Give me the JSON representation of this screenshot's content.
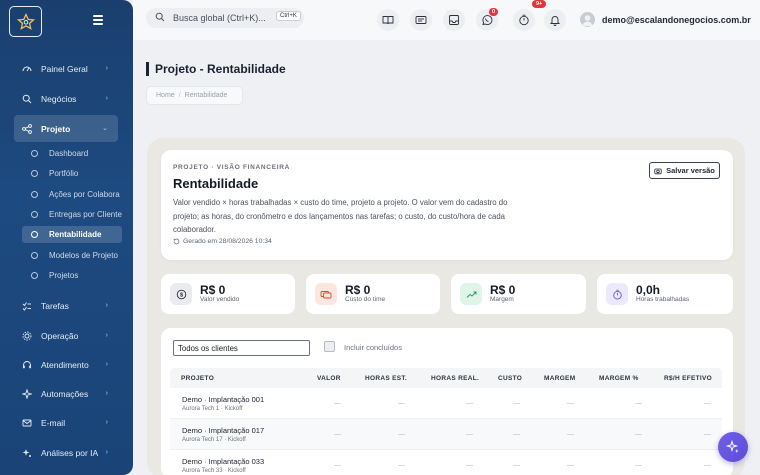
{
  "sidebar": {
    "items": [
      {
        "label": "Painel Geral",
        "icon": "dashboard-icon"
      },
      {
        "label": "Negócios",
        "icon": "search-icon"
      },
      {
        "label": "Projeto",
        "icon": "share-icon"
      },
      {
        "label": "Tarefas",
        "icon": "tasks-icon"
      },
      {
        "label": "Operação",
        "icon": "operation-icon"
      },
      {
        "label": "Atendimento",
        "icon": "headset-icon"
      },
      {
        "label": "Automações",
        "icon": "automation-icon"
      },
      {
        "label": "E-mail",
        "icon": "mail-icon"
      },
      {
        "label": "Análises por IA",
        "icon": "ai-icon"
      }
    ],
    "sub_items": [
      {
        "label": "Dashboard"
      },
      {
        "label": "Portfólio"
      },
      {
        "label": "Ações por Colabora"
      },
      {
        "label": "Entregas por Cliente"
      },
      {
        "label": "Rentabilidade"
      },
      {
        "label": "Modelos de Projeto"
      },
      {
        "label": "Projetos"
      }
    ]
  },
  "topbar": {
    "search_placeholder": "Busca global (Ctrl+K)...",
    "shortcut": "Ctrl+K",
    "whatsapp_badge": "0",
    "notifications_badge": "9+",
    "user_email": "demo@escalandonegocios.com.br"
  },
  "page": {
    "title": "Projeto - Rentabilidade",
    "breadcrumb_home": "Home",
    "breadcrumb_current": "Rentabilidade"
  },
  "hero": {
    "kicker": "PROJETO · VISÃO FINANCEIRA",
    "title": "Rentabilidade",
    "description": "Valor vendido × horas trabalhadas × custo do time, projeto a projeto. O valor vem do cadastro do projeto; as horas, do cronômetro e dos lançamentos nas tarefas; o custo, do custo/hora de cada colaborador.",
    "generated": "Gerado em 28/08/2026 10:34",
    "save_label": "Salvar versão"
  },
  "kpis": [
    {
      "value": "R$ 0",
      "label": "Valor vendido",
      "color": "#e9ebef"
    },
    {
      "value": "R$ 0",
      "label": "Custo do time",
      "color": "#fde6e0"
    },
    {
      "value": "R$ 0",
      "label": "Margem",
      "color": "#dff5e8"
    },
    {
      "value": "0,0h",
      "label": "Horas trabalhadas",
      "color": "#ebe9fb"
    }
  ],
  "filters": {
    "client_select": "Todos os clientes",
    "include_done_label": "Incluir concluídos"
  },
  "table": {
    "columns": [
      "PROJETO",
      "VALOR",
      "HORAS EST.",
      "HORAS REAL.",
      "CUSTO",
      "MARGEM",
      "MARGEM %",
      "R$/H EFETIVO"
    ],
    "rows": [
      {
        "name": "Demo · Implantação 001",
        "sub": "Aurora Tech 1 · Kickoff",
        "cells": [
          "—",
          "—",
          "—",
          "—",
          "—",
          "—",
          "—"
        ]
      },
      {
        "name": "Demo · Implantação 017",
        "sub": "Aurora Tech 17 · Kickoff",
        "cells": [
          "—",
          "—",
          "—",
          "—",
          "—",
          "—",
          "—"
        ]
      },
      {
        "name": "Demo · Implantação 033",
        "sub": "Aurora Tech 33 · Kickoff",
        "cells": [
          "—",
          "—",
          "—",
          "—",
          "—",
          "—",
          "—"
        ]
      }
    ]
  }
}
